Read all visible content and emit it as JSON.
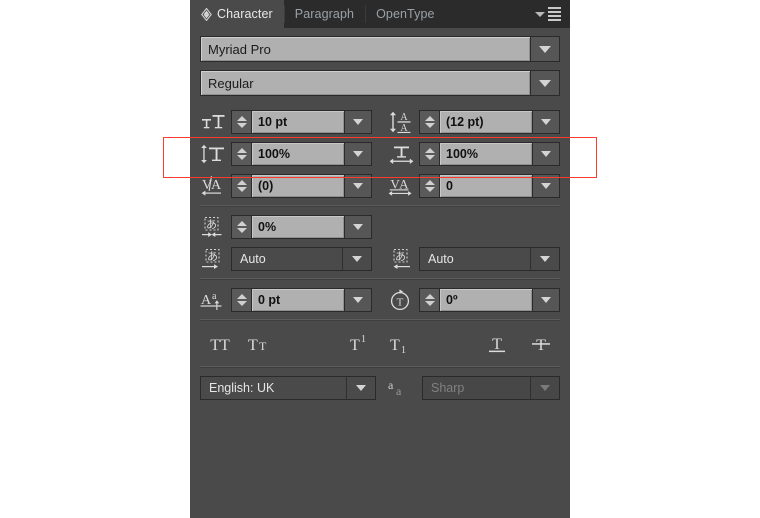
{
  "panel": {
    "title": "Character",
    "tabs": [
      {
        "label": "Character",
        "active": true,
        "icon": "diamond-arrows-icon"
      },
      {
        "label": "Paragraph",
        "active": false
      },
      {
        "label": "OpenType",
        "active": false
      }
    ],
    "menu_icon": "panel-menu-icon"
  },
  "font": {
    "family_value": "Myriad Pro",
    "style_value": "Regular"
  },
  "size_row": {
    "font_size": {
      "icon": "font-size-icon",
      "value": "10 pt"
    },
    "leading": {
      "icon": "leading-icon",
      "value": "(12 pt)"
    }
  },
  "scale_row": {
    "vertical_scale": {
      "icon": "vertical-scale-icon",
      "value": "100%"
    },
    "horizontal_scale": {
      "icon": "horizontal-scale-icon",
      "value": "100%"
    }
  },
  "spacing_row": {
    "kerning": {
      "icon": "kerning-icon",
      "value": "(0)"
    },
    "tracking": {
      "icon": "tracking-icon",
      "value": "0"
    }
  },
  "tsume_row": {
    "tsume": {
      "icon": "tsume-icon",
      "value": "0%"
    }
  },
  "aki_row": {
    "aki_before": {
      "icon": "aki-before-icon",
      "value": "Auto"
    },
    "aki_after": {
      "icon": "aki-after-icon",
      "value": "Auto"
    }
  },
  "baseline_row": {
    "baseline_shift": {
      "icon": "baseline-shift-icon",
      "value": "0 pt"
    },
    "character_rotation": {
      "icon": "character-rotation-icon",
      "value": "0º"
    }
  },
  "style_buttons": [
    {
      "name": "all-caps-button",
      "label": "TT"
    },
    {
      "name": "small-caps-button",
      "label": "Tт"
    },
    {
      "name": "superscript-button",
      "label": "T¹"
    },
    {
      "name": "subscript-button",
      "label": "T₁"
    },
    {
      "name": "underline-button",
      "label": "T"
    },
    {
      "name": "strikethrough-button",
      "label": "T"
    }
  ],
  "bottom_row": {
    "language": {
      "value": "English: UK"
    },
    "antialias": {
      "icon": "anti-alias-icon",
      "value": "Sharp",
      "disabled": true
    }
  },
  "annotation": {
    "highlight_color": "#ff3b30",
    "highlight_label": "font-size-and-leading-highlight"
  },
  "colors": {
    "panel_bg": "#4a4a4a",
    "tabbar_bg": "#2b2b2b",
    "field_bg": "#b0b0b0",
    "text_light": "#e6e6e6",
    "text_dark": "#111111"
  }
}
